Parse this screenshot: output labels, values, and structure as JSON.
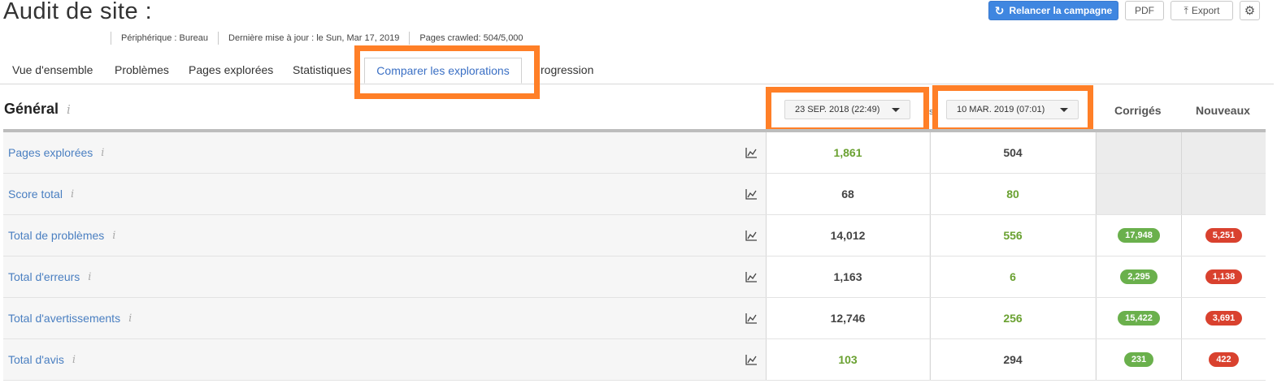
{
  "page": {
    "title": "Audit de site :",
    "meta": [
      "Périphérique : Bureau",
      "Dernière mise à jour : le Sun, Mar 17, 2019",
      "Pages crawled: 504/5,000"
    ]
  },
  "toolbar": {
    "relaunch_label": "Relancer la campagne",
    "pdf_label": "PDF",
    "export_label": "Export"
  },
  "tabs": [
    {
      "label": "Vue d'ensemble"
    },
    {
      "label": "Problèmes"
    },
    {
      "label": "Pages explorées"
    },
    {
      "label": "Statistiques"
    },
    {
      "label": "Comparer les explorations",
      "active": true
    },
    {
      "label": "rogression"
    }
  ],
  "section": {
    "title": "Général",
    "info_glyph": "i",
    "stray": "s",
    "date1": "23 SEP. 2018 (22:49)",
    "date2": "10 MAR. 2019 (07:01)",
    "col_fixed": "Corrigés",
    "col_new": "Nouveaux"
  },
  "rows": [
    {
      "label": "Pages explorées",
      "v1": "1,861",
      "v2": "504",
      "fixed": "",
      "new": ""
    },
    {
      "label": "Score total",
      "v1": "68",
      "v2": "80",
      "fixed": "",
      "new": ""
    },
    {
      "label": "Total de problèmes",
      "v1": "14,012",
      "v2": "556",
      "fixed": "17,948",
      "new": "5,251"
    },
    {
      "label": "Total d'erreurs",
      "v1": "1,163",
      "v2": "6",
      "fixed": "2,295",
      "new": "1,138"
    },
    {
      "label": "Total d'avertissements",
      "v1": "12,746",
      "v2": "256",
      "fixed": "15,422",
      "new": "3,691"
    },
    {
      "label": "Total d'avis",
      "v1": "103",
      "v2": "294",
      "fixed": "231",
      "new": "422"
    }
  ],
  "colors": {
    "accent": "#3f86e0",
    "highlight": "#ff7f27",
    "positive": "#6aa131",
    "negative": "#d9412e"
  },
  "icons": {
    "relaunch": "refresh-icon",
    "export": "upload-icon",
    "settings": "gear-icon",
    "trend": "line-chart-icon",
    "info": "info-icon"
  }
}
